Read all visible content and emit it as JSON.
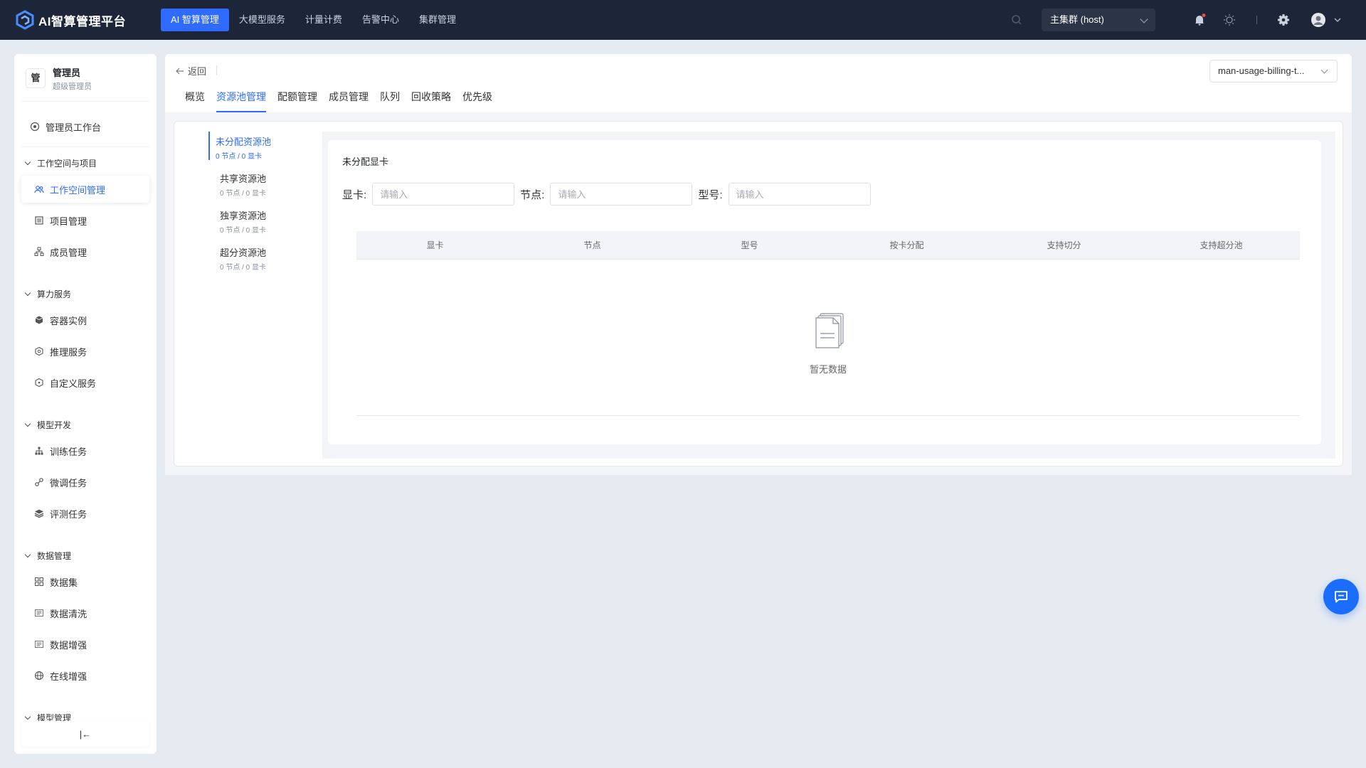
{
  "app": {
    "title": "AI智算管理平台"
  },
  "topnav": {
    "items": [
      "AI 智算管理",
      "大模型服务",
      "计量计费",
      "告警中心",
      "集群管理"
    ]
  },
  "cluster": {
    "selected": "主集群 (host)"
  },
  "user": {
    "avatar_char": "管",
    "name": "管理员",
    "role": "超级管理员"
  },
  "sidebar": {
    "workbench": "管理员工作台",
    "groups": [
      {
        "label": "工作空间与项目",
        "items": [
          "工作空间管理",
          "项目管理",
          "成员管理"
        ]
      },
      {
        "label": "算力服务",
        "items": [
          "容器实例",
          "推理服务",
          "自定义服务"
        ]
      },
      {
        "label": "模型开发",
        "items": [
          "训练任务",
          "微调任务",
          "评测任务"
        ]
      },
      {
        "label": "数据管理",
        "items": [
          "数据集",
          "数据清洗",
          "数据增强",
          "在线增强"
        ]
      },
      {
        "label": "模型管理",
        "items": []
      }
    ],
    "collapse_label": "|←"
  },
  "header": {
    "back_label": "返回",
    "workspace_select": "man-usage-billing-t...",
    "tabs": [
      "概览",
      "资源池管理",
      "配额管理",
      "成员管理",
      "队列",
      "回收策略",
      "优先级"
    ]
  },
  "pools": [
    {
      "name": "未分配资源池",
      "meta": "0 节点 / 0 显卡"
    },
    {
      "name": "共享资源池",
      "meta": "0 节点 / 0 显卡"
    },
    {
      "name": "独享资源池",
      "meta": "0 节点 / 0 显卡"
    },
    {
      "name": "超分资源池",
      "meta": "0 节点 / 0 显卡"
    }
  ],
  "detail": {
    "title": "未分配显卡",
    "filters": [
      {
        "label": "显卡:",
        "placeholder": "请输入"
      },
      {
        "label": "节点:",
        "placeholder": "请输入"
      },
      {
        "label": "型号:",
        "placeholder": "请输入"
      }
    ],
    "columns": [
      "显卡",
      "节点",
      "型号",
      "按卡分配",
      "支持切分",
      "支持超分池"
    ],
    "empty_text": "暂无数据"
  },
  "colors": {
    "accent": "#2f6bff",
    "topbar": "#1d2638",
    "background": "#e6ebf2"
  }
}
